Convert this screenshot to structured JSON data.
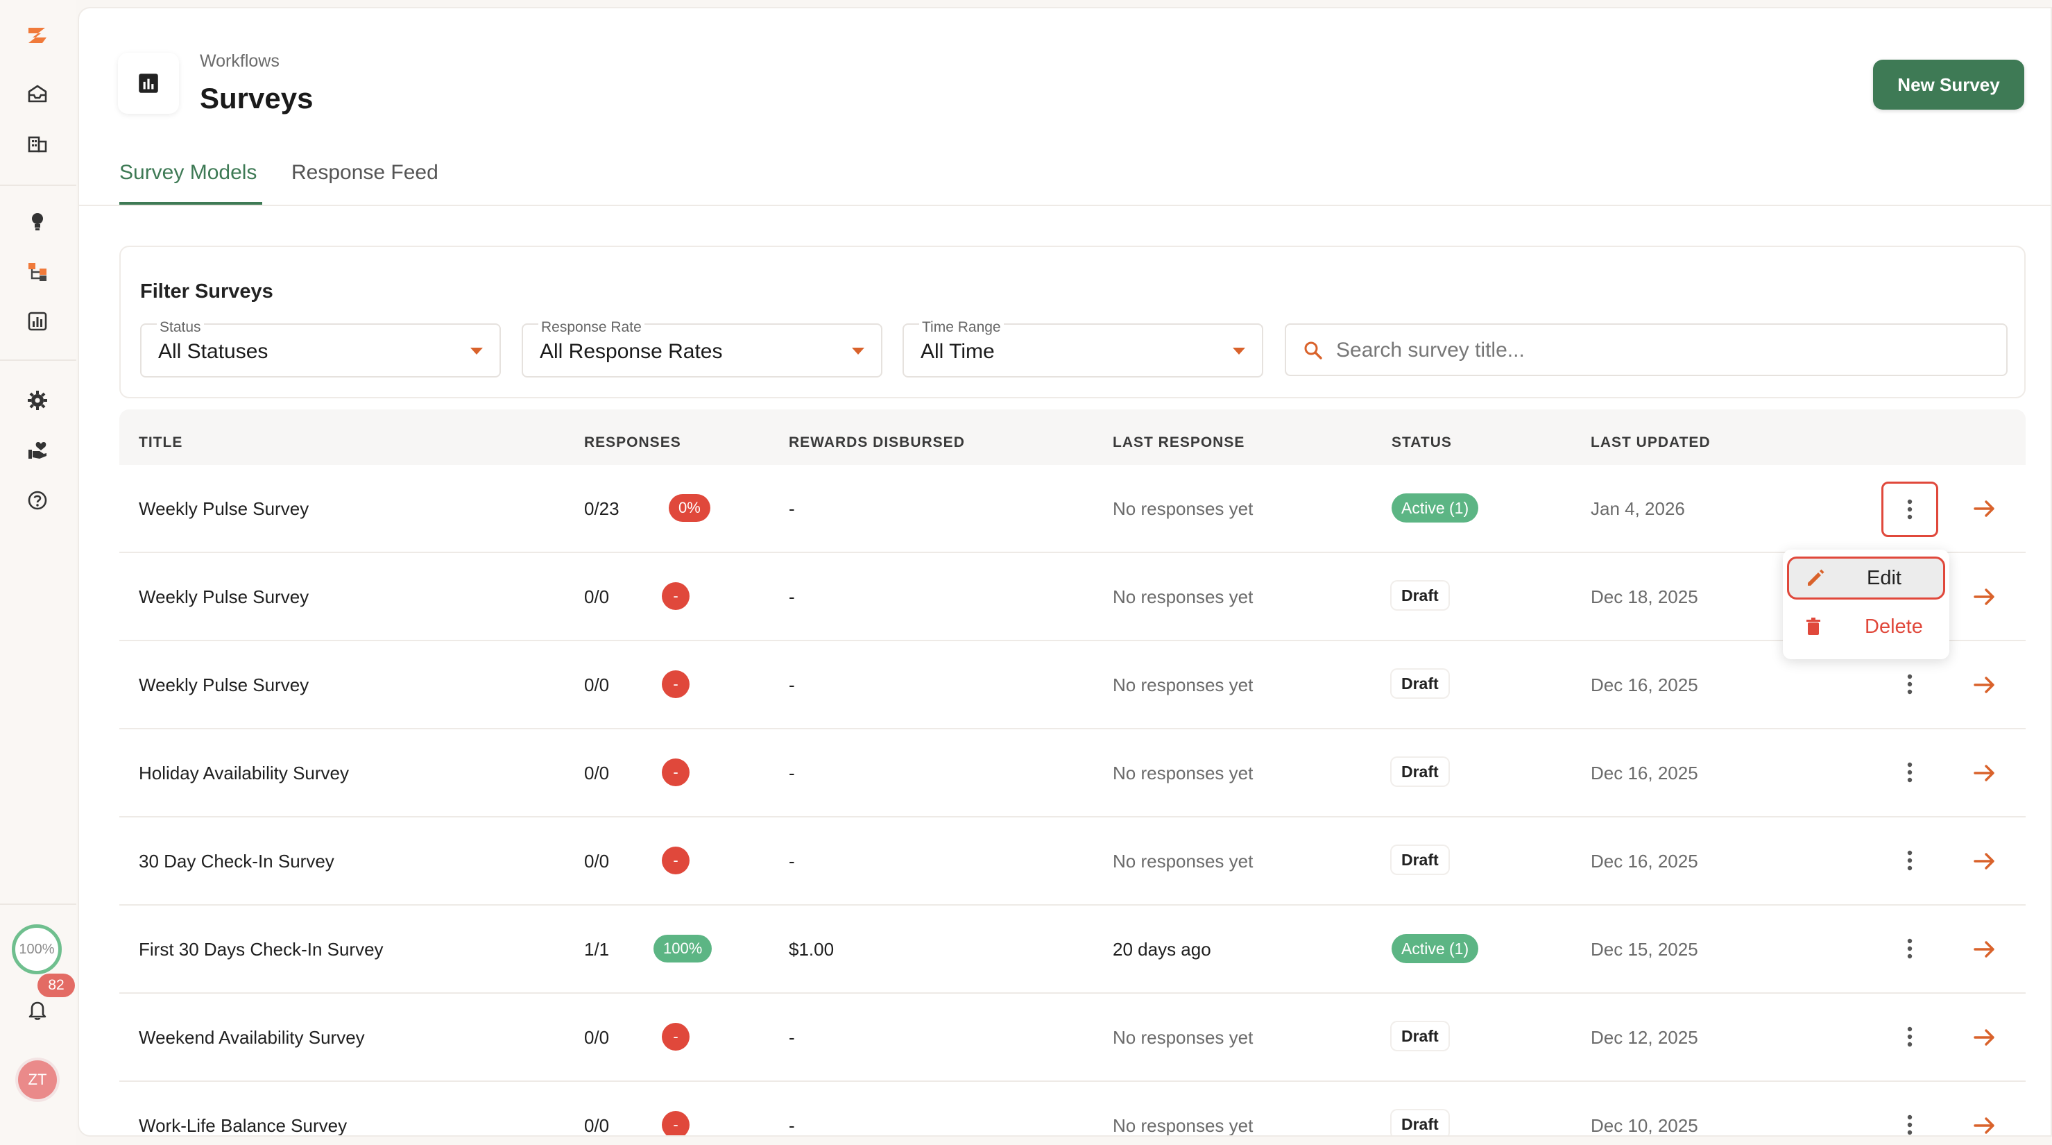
{
  "sidebar": {
    "items": [
      {
        "name": "logo-icon"
      },
      {
        "name": "inbox-icon"
      },
      {
        "name": "building-icon"
      },
      {
        "name": "lightbulb-icon"
      },
      {
        "name": "workflow-icon"
      },
      {
        "name": "chart-icon"
      },
      {
        "name": "settings-icon"
      },
      {
        "name": "heart-hand-icon"
      },
      {
        "name": "help-icon"
      }
    ],
    "progress_label": "100%",
    "notification_count": "82",
    "avatar_initials": "ZT"
  },
  "header": {
    "breadcrumb": "Workflows",
    "title": "Surveys",
    "new_button_label": "New Survey"
  },
  "tabs": [
    {
      "label": "Survey Models",
      "active": true
    },
    {
      "label": "Response Feed",
      "active": false
    }
  ],
  "filters": {
    "title": "Filter Surveys",
    "status": {
      "label": "Status",
      "value": "All Statuses"
    },
    "response_rate": {
      "label": "Response Rate",
      "value": "All Response Rates"
    },
    "time_range": {
      "label": "Time Range",
      "value": "All Time"
    },
    "search_placeholder": "Search survey title..."
  },
  "table": {
    "columns": [
      "TITLE",
      "RESPONSES",
      "REWARDS DISBURSED",
      "LAST RESPONSE",
      "STATUS",
      "LAST UPDATED"
    ],
    "rows": [
      {
        "title": "Weekly Pulse Survey",
        "responses": "0/23",
        "rate": "0%",
        "rewards": "-",
        "last_response": "No responses yet",
        "status": "Active (1)",
        "updated": "Jan 4, 2026"
      },
      {
        "title": "Weekly Pulse Survey",
        "responses": "0/0",
        "rate": "-",
        "rewards": "-",
        "last_response": "No responses yet",
        "status": "Draft",
        "updated": "Dec 18, 2025"
      },
      {
        "title": "Weekly Pulse Survey",
        "responses": "0/0",
        "rate": "-",
        "rewards": "-",
        "last_response": "No responses yet",
        "status": "Draft",
        "updated": "Dec 16, 2025"
      },
      {
        "title": "Holiday Availability Survey",
        "responses": "0/0",
        "rate": "-",
        "rewards": "-",
        "last_response": "No responses yet",
        "status": "Draft",
        "updated": "Dec 16, 2025"
      },
      {
        "title": "30 Day Check-In Survey",
        "responses": "0/0",
        "rate": "-",
        "rewards": "-",
        "last_response": "No responses yet",
        "status": "Draft",
        "updated": "Dec 16, 2025"
      },
      {
        "title": "First 30 Days Check-In Survey",
        "responses": "1/1",
        "rate": "100%",
        "rewards": "$1.00",
        "last_response": "20 days ago",
        "status": "Active (1)",
        "updated": "Dec 15, 2025"
      },
      {
        "title": "Weekend Availability Survey",
        "responses": "0/0",
        "rate": "-",
        "rewards": "-",
        "last_response": "No responses yet",
        "status": "Draft",
        "updated": "Dec 12, 2025"
      },
      {
        "title": "Work-Life Balance Survey",
        "responses": "0/0",
        "rate": "-",
        "rewards": "-",
        "last_response": "No responses yet",
        "status": "Draft",
        "updated": "Dec 10, 2025"
      }
    ]
  },
  "row_menu": {
    "edit_label": "Edit",
    "delete_label": "Delete"
  },
  "colors": {
    "brand_green": "#3e7a55",
    "accent_orange": "#d9622b",
    "danger_red": "#e0483b",
    "active_green": "#5cb584"
  }
}
